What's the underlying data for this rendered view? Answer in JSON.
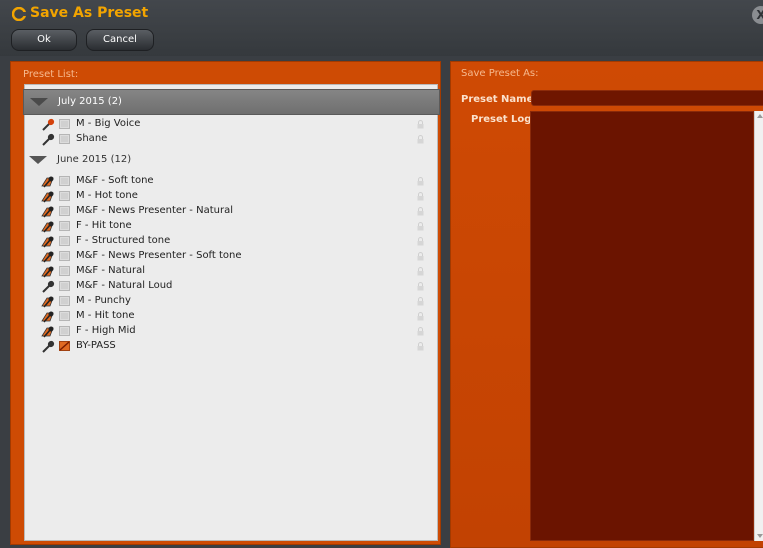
{
  "window": {
    "title": "Save As Preset",
    "close_glyph": "X"
  },
  "toolbar": {
    "ok_label": "Ok",
    "cancel_label": "Cancel"
  },
  "preset_list": {
    "title": "Preset List:",
    "groups": [
      {
        "label": "July 2015 (2)",
        "items": [
          {
            "label": "M - Big Voice",
            "icon": "mic-red-icon"
          },
          {
            "label": "Shane",
            "icon": "mic-dark-icon"
          }
        ]
      },
      {
        "label": "June 2015 (12)",
        "items": [
          {
            "label": "M&F - Soft tone",
            "icon": "preset-edit-icon"
          },
          {
            "label": "M - Hot tone",
            "icon": "preset-edit-icon"
          },
          {
            "label": "M&F - News Presenter - Natural",
            "icon": "preset-edit-icon"
          },
          {
            "label": "F - Hit tone",
            "icon": "preset-edit-icon"
          },
          {
            "label": "F - Structured tone",
            "icon": "preset-edit-icon"
          },
          {
            "label": "M&F - News Presenter - Soft tone",
            "icon": "preset-edit-icon"
          },
          {
            "label": "M&F - Natural",
            "icon": "preset-edit-icon"
          },
          {
            "label": "M&F - Natural Loud",
            "icon": "mic-dark-icon"
          },
          {
            "label": "M - Punchy",
            "icon": "preset-edit-icon"
          },
          {
            "label": "M - Hit tone",
            "icon": "preset-edit-icon"
          },
          {
            "label": "F - High Mid",
            "icon": "preset-edit-icon"
          },
          {
            "label": "BY-PASS",
            "icon": "mic-dark-icon"
          }
        ]
      }
    ]
  },
  "save_form": {
    "title": "Save Preset As:",
    "name_label": "Preset Name",
    "name_value": "",
    "log_label": "Preset Log",
    "log_value": ""
  },
  "colors": {
    "accent": "#f2a400",
    "panel": "#ce4b04",
    "input_bg": "#6b1400",
    "list_bg": "#ececec"
  }
}
